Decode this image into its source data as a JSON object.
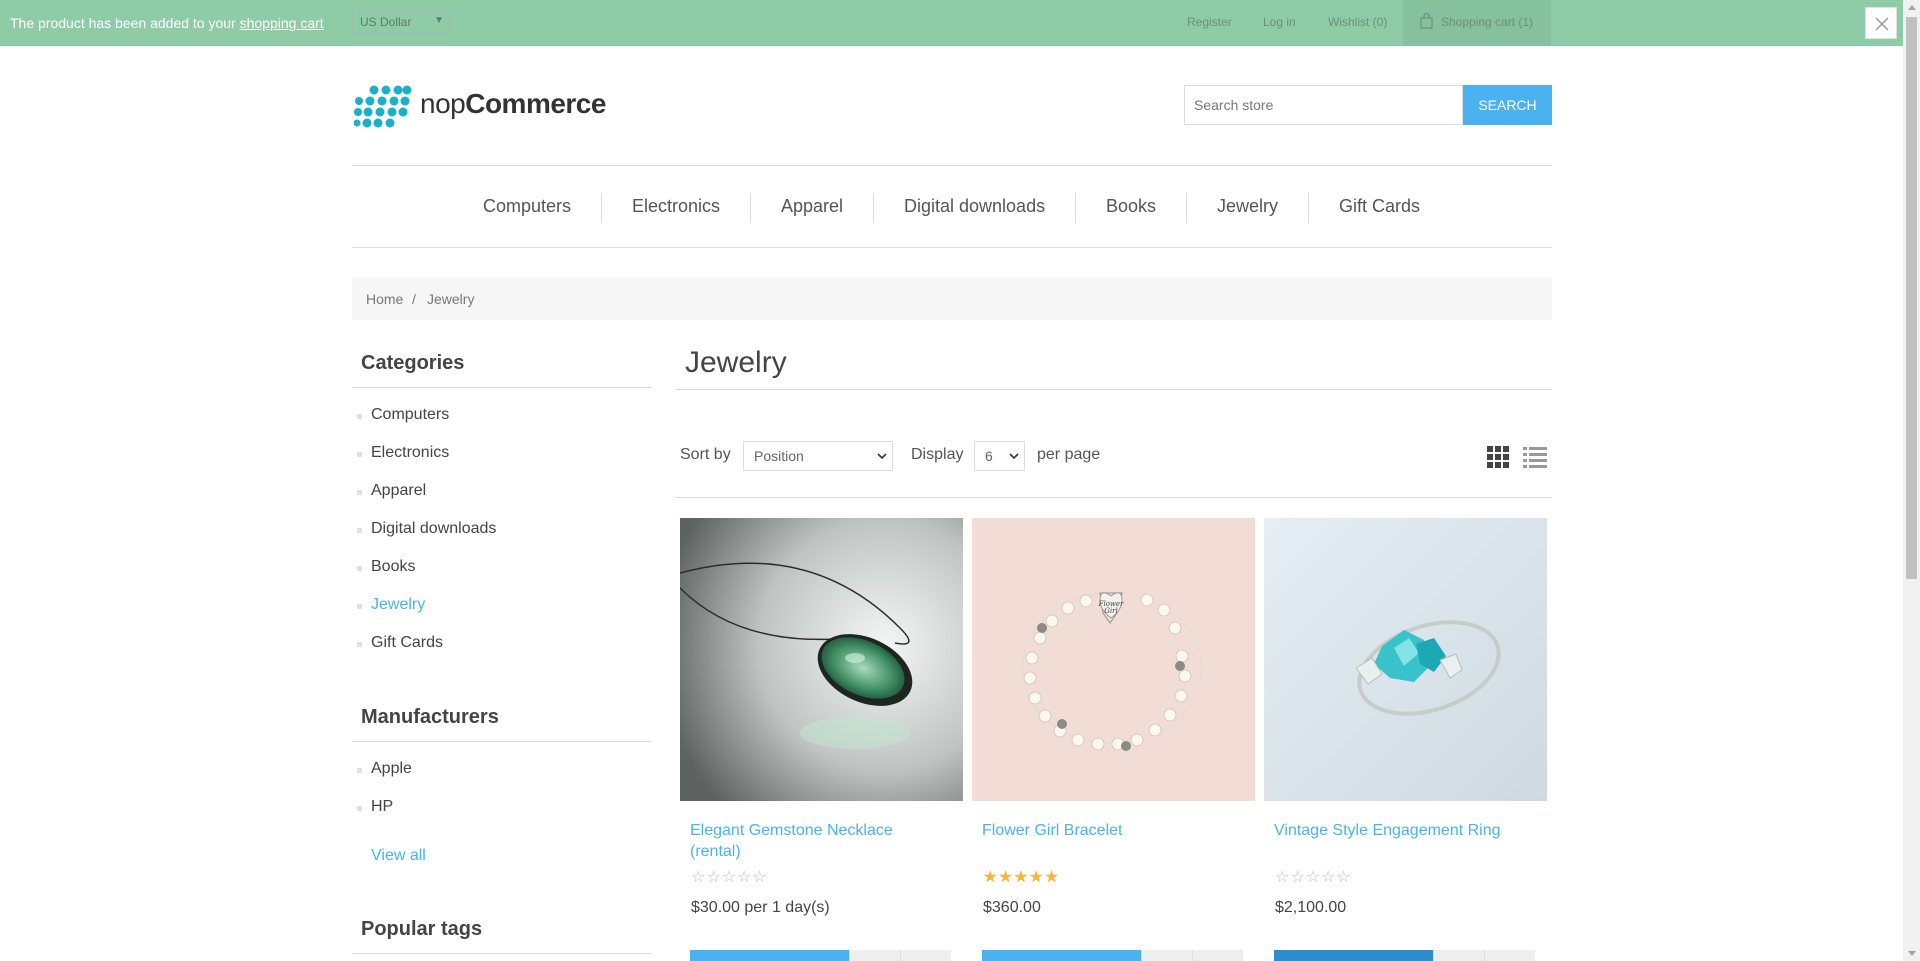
{
  "notification": {
    "message": "The product has been added to your ",
    "link_text": "shopping cart"
  },
  "header": {
    "currency": "US Dollar",
    "register": "Register",
    "login": "Log in",
    "wishlist": "Wishlist (0)",
    "cart": "Shopping cart (1)",
    "logo_regular": "nop",
    "logo_bold": "Commerce",
    "search_placeholder": "Search store",
    "search_button": "SEARCH"
  },
  "top_menu": [
    "Computers",
    "Electronics",
    "Apparel",
    "Digital downloads",
    "Books",
    "Jewelry",
    "Gift Cards"
  ],
  "breadcrumb": {
    "home": "Home",
    "separator": "/",
    "current": "Jewelry"
  },
  "sidebar": {
    "categories_title": "Categories",
    "categories": [
      "Computers",
      "Electronics",
      "Apparel",
      "Digital downloads",
      "Books",
      "Jewelry",
      "Gift Cards"
    ],
    "active_category": "Jewelry",
    "manufacturers_title": "Manufacturers",
    "manufacturers": [
      "Apple",
      "HP"
    ],
    "view_all": "View all",
    "popular_tags_title": "Popular tags"
  },
  "main": {
    "title": "Jewelry",
    "sort_label": "Sort by",
    "sort_value": "Position",
    "display_label": "Display",
    "display_value": "6",
    "per_page_label": "per page",
    "view_mode": "grid"
  },
  "products": [
    {
      "name_line1": "Elegant Gemstone Necklace",
      "name_line2": "(rental)",
      "rating": 0,
      "price": "$30.00 per 1 day(s)"
    },
    {
      "name_line1": "Flower Girl Bracelet",
      "name_line2": "",
      "rating": 5,
      "price": "$360.00"
    },
    {
      "name_line1": "Vintage Style Engagement Ring",
      "name_line2": "",
      "rating": 0,
      "price": "$2,100.00"
    }
  ],
  "colors": {
    "accent": "#4ab2f1",
    "notification": "#8ecba7",
    "star": "#f6b73c"
  }
}
